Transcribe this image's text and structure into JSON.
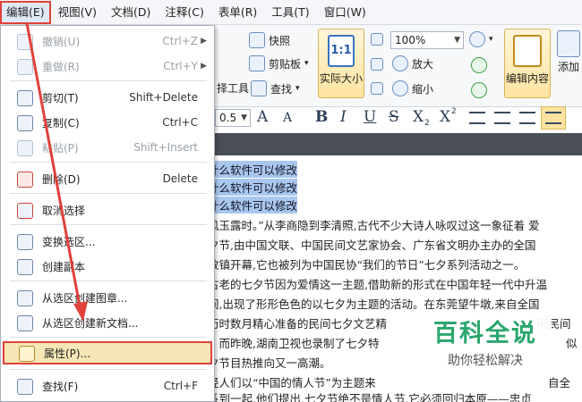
{
  "menubar": {
    "items": [
      {
        "label": "编辑(E)"
      },
      {
        "label": "视图(V)"
      },
      {
        "label": "文档(D)"
      },
      {
        "label": "注释(C)"
      },
      {
        "label": "表单(R)"
      },
      {
        "label": "工具(T)"
      },
      {
        "label": "窗口(W)"
      }
    ]
  },
  "ribbon": {
    "snapshot": "快照",
    "clipboard": "剪贴板",
    "tools_partial": "择工具",
    "find": "查找",
    "actual_size": "实际大小",
    "actual_size_icon": "1:1",
    "zoom_value": "100%",
    "zoom_in": "放大",
    "zoom_out": "缩小",
    "edit_content": "编辑内容",
    "add_partial": "添加",
    "font_size_partial": "0.5",
    "format_buttons": [
      "A",
      "A",
      "B",
      "I",
      "U",
      "S",
      "X",
      "X"
    ]
  },
  "document": {
    "lines": [
      "什么软件可以修改",
      "什么软件可以修改",
      "什么软件可以修改",
      "风玉露时。”从李商隐到李清照,古代不少大诗人咏叹过这一象征着 爱",
      "夕节,由中国文联、中国民间文艺家协会、广东省文明办主办的全国",
      "数镇开幕,它也被列为中国民协“我们的节日”七夕系列活动之一。",
      "古老的七夕节因为爱情这一主题,借助新的形式在中国年轻一代中升温",
      "间,出现了形形色色的以七夕为主题的活动。在东莞望牛墩,来自全国",
      "历时数月精心准备的民间七夕文艺精",
      "。而昨晚,湖南卫视也录制了七夕特",
      "夕节目热推向又一高潮。",
      "轻人们以“中国的情人节”为主题来",
      "系到一起,他们提出,七夕节绝不是情人节,它必须回归本原——忠贞"
    ],
    "line_right_fragments": [
      "间民间",
      "似",
      "自全"
    ]
  },
  "dropdown": {
    "items": [
      {
        "label": "撤销(U)",
        "shortcut": "Ctrl+Z",
        "icon": "undo-icon",
        "disabled": true,
        "submenu": true
      },
      {
        "label": "重做(R)",
        "shortcut": "Ctrl+Y",
        "icon": "redo-icon",
        "disabled": true,
        "submenu": true
      },
      {
        "label": "剪切(T)",
        "shortcut": "Shift+Delete",
        "icon": "scissors-icon",
        "disabled": false,
        "submenu": false
      },
      {
        "label": "复制(C)",
        "shortcut": "Ctrl+C",
        "icon": "copy-icon",
        "disabled": false,
        "submenu": false
      },
      {
        "label": "粘贴(P)",
        "shortcut": "Shift+Insert",
        "icon": "paste-icon",
        "disabled": true,
        "submenu": false
      },
      {
        "label": "删除(D)",
        "shortcut": "Delete",
        "icon": "trash-icon",
        "disabled": false,
        "submenu": false
      },
      {
        "label": "取消选择",
        "shortcut": "",
        "icon": "deselect-icon",
        "disabled": false,
        "submenu": false
      },
      {
        "label": "变换选区...",
        "shortcut": "",
        "icon": "transform-selection-icon",
        "disabled": false,
        "submenu": false
      },
      {
        "label": "创建副本",
        "shortcut": "",
        "icon": "duplicate-icon",
        "disabled": false,
        "submenu": false
      },
      {
        "label": "从选区创建图章...",
        "shortcut": "",
        "icon": "stamp-icon",
        "disabled": false,
        "submenu": false
      },
      {
        "label": "从选区创建新文档...",
        "shortcut": "",
        "icon": "new-document-icon",
        "disabled": false,
        "submenu": false
      },
      {
        "label": "属性(P)...",
        "shortcut": "",
        "icon": "properties-icon",
        "disabled": false,
        "submenu": false
      },
      {
        "label": "查找(F)",
        "shortcut": "Ctrl+F",
        "icon": "find-icon",
        "disabled": false,
        "submenu": false
      }
    ]
  },
  "watermark": {
    "title": "百科全说",
    "subtitle": "助你轻松解决"
  },
  "colors": {
    "highlight_border": "#e0413b",
    "selection": "#a9c7ee",
    "watermark_green": "#2aa66d"
  }
}
